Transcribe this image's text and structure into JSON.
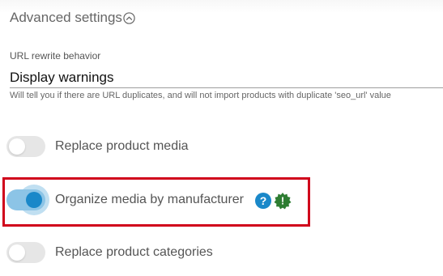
{
  "advanced_settings": {
    "title": "Advanced settings",
    "toggle_icon": "chevron-up-circle-icon"
  },
  "url_rewrite": {
    "label": "URL rewrite behavior",
    "value": "Display warnings",
    "hint": "Will tell you if there are URL duplicates, and will not import products with duplicate 'seo_url' value"
  },
  "toggles": [
    {
      "label": "Replace product media",
      "on": false
    },
    {
      "label": "Organize media by manufacturer",
      "on": true
    },
    {
      "label": "Replace product categories",
      "on": false
    }
  ],
  "icons": {
    "help": "help-icon",
    "help_glyph": "?",
    "badge": "seal-warning-icon",
    "badge_glyph": "!"
  },
  "colors": {
    "accent": "#1a88c9",
    "toggle_on_track": "#8cc4e6",
    "highlight": "#d0021b",
    "badge": "#2e7d32"
  }
}
